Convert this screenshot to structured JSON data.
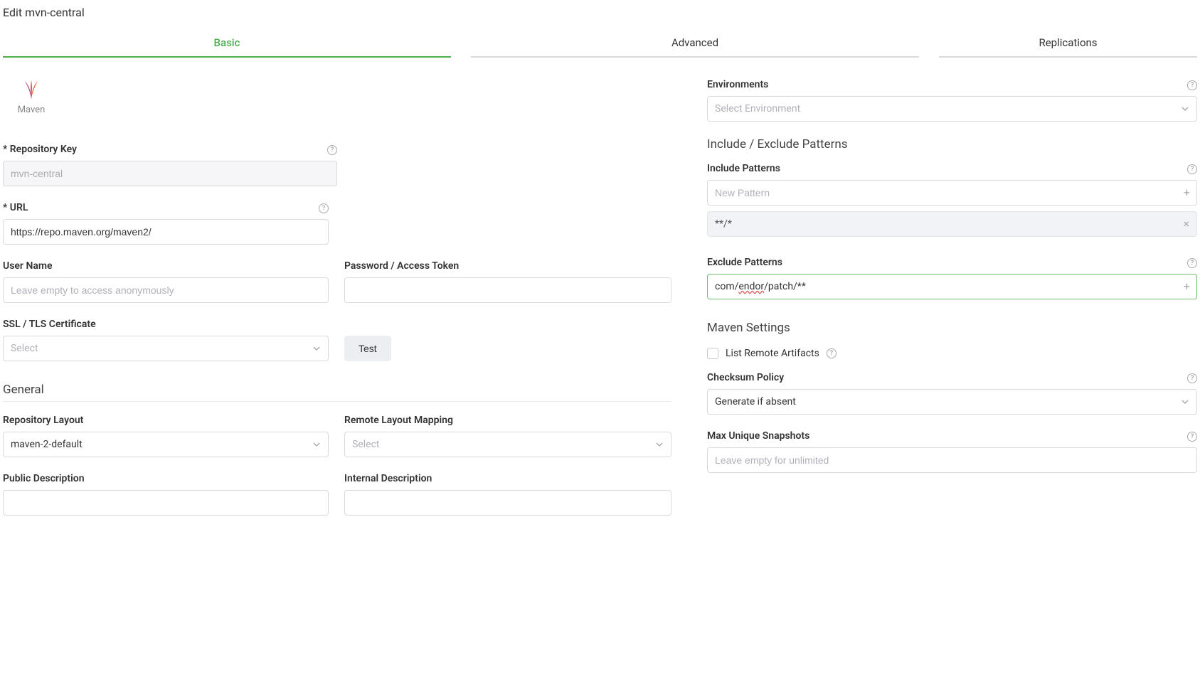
{
  "pageTitle": "Edit mvn-central",
  "tabs": {
    "basic": "Basic",
    "advanced": "Advanced",
    "replications": "Replications"
  },
  "packageType": {
    "label": "Maven"
  },
  "left": {
    "repoKey": {
      "label": "* Repository Key",
      "value": "mvn-central"
    },
    "url": {
      "label": "* URL",
      "value": "https://repo.maven.org/maven2/"
    },
    "username": {
      "label": "User Name",
      "placeholder": "Leave empty to access anonymously"
    },
    "password": {
      "label": "Password / Access Token"
    },
    "ssl": {
      "label": "SSL / TLS Certificate",
      "placeholder": "Select"
    },
    "testBtn": "Test",
    "generalHeading": "General",
    "repoLayout": {
      "label": "Repository Layout",
      "value": "maven-2-default"
    },
    "remoteMapping": {
      "label": "Remote Layout Mapping",
      "placeholder": "Select"
    },
    "pubDesc": {
      "label": "Public Description"
    },
    "intDesc": {
      "label": "Internal Description"
    }
  },
  "right": {
    "environments": {
      "label": "Environments",
      "placeholder": "Select Environment"
    },
    "patternsHeading": "Include / Exclude Patterns",
    "includeLabel": "Include Patterns",
    "includePlaceholder": "New Pattern",
    "includeChip": "**/*",
    "excludeLabel": "Exclude Patterns",
    "excludeValuePrefix": "com/",
    "excludeValueMid": "endor",
    "excludeValueSuffix": "/patch/**",
    "mavenSettingsHeading": "Maven Settings",
    "listRemoteLabel": "List Remote Artifacts",
    "checksum": {
      "label": "Checksum Policy",
      "value": "Generate if absent"
    },
    "maxSnapshots": {
      "label": "Max Unique Snapshots",
      "placeholder": "Leave empty for unlimited"
    }
  }
}
